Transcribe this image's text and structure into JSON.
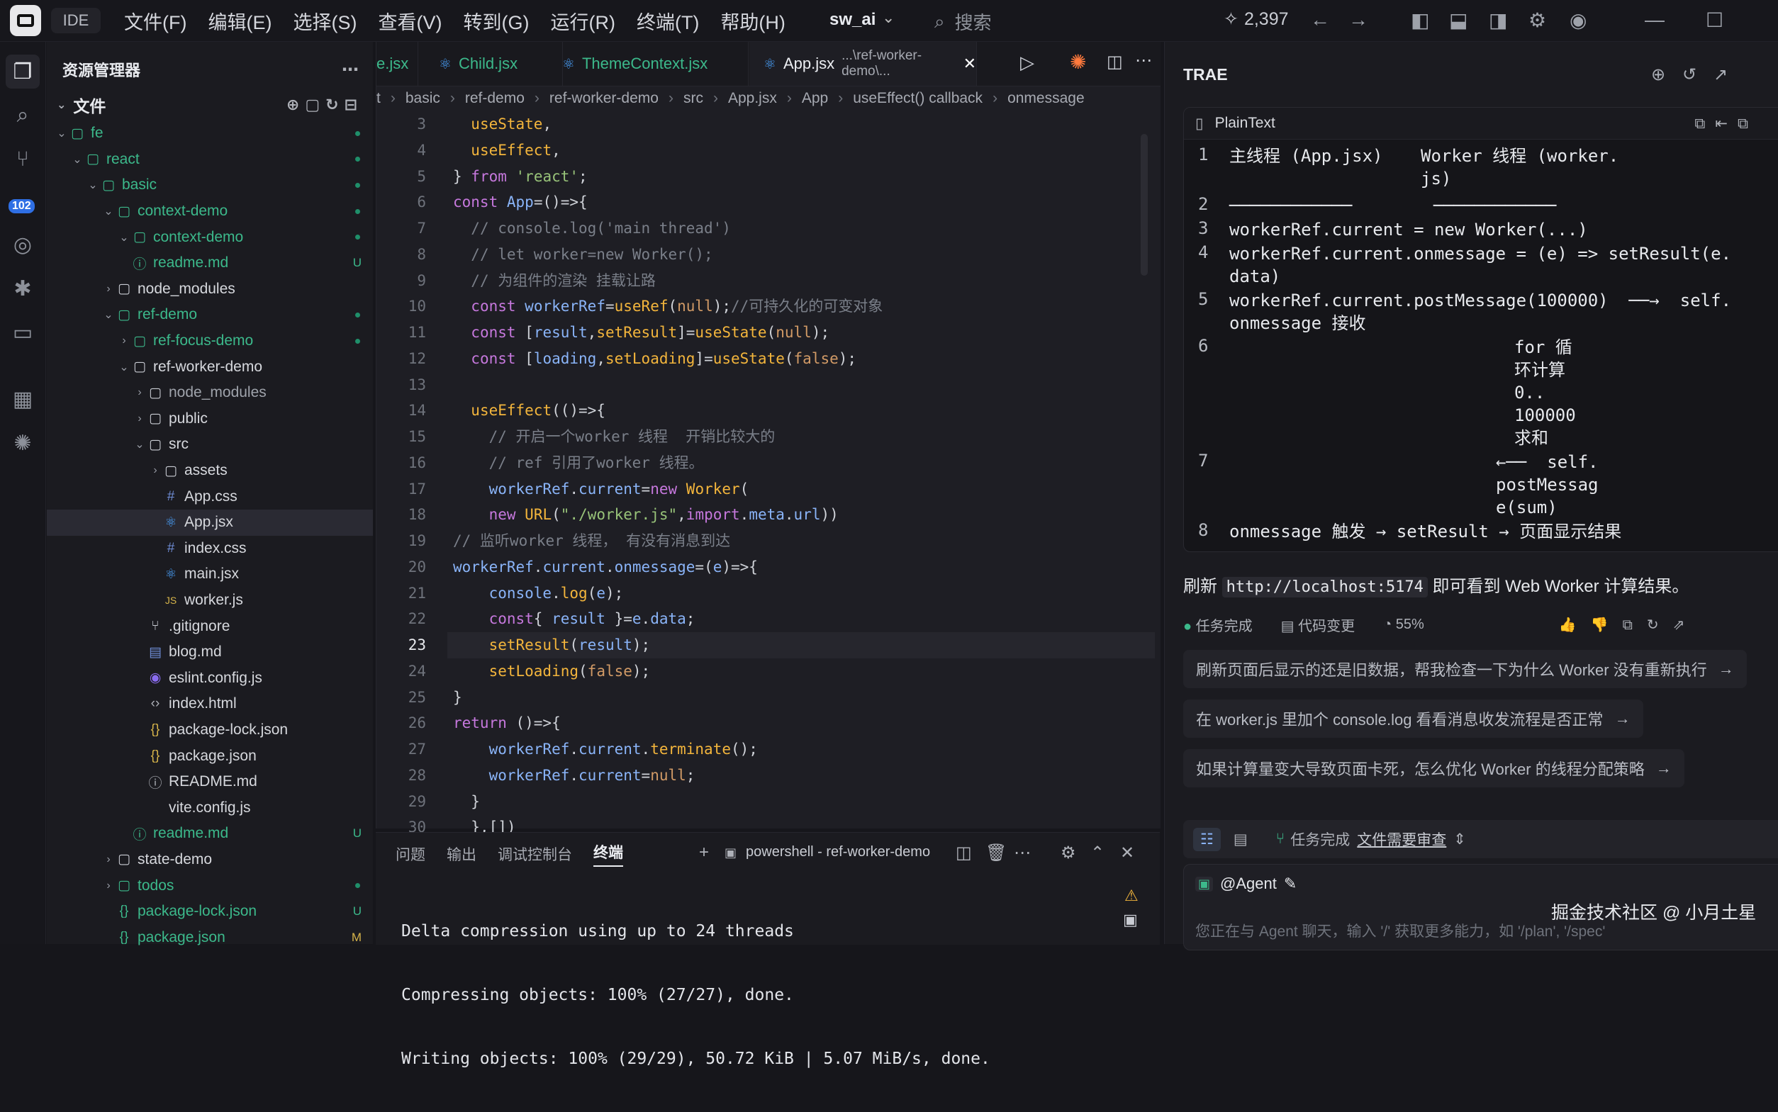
{
  "titlebar": {
    "ide_label": "IDE",
    "menus": [
      "文件(F)",
      "编辑(E)",
      "选择(S)",
      "查看(V)",
      "转到(G)",
      "运行(R)",
      "终端(T)",
      "帮助(H)"
    ],
    "project": "sw_ai",
    "search_placeholder": "搜索",
    "credits": "2,397"
  },
  "activity": {
    "badge": "102"
  },
  "sidebar": {
    "title": "资源管理器",
    "section": "文件",
    "tree": [
      {
        "label": "fe",
        "depth": 0,
        "kind": "folder",
        "open": true,
        "color": "green",
        "status": "dot"
      },
      {
        "label": "react",
        "depth": 1,
        "kind": "folder",
        "open": true,
        "color": "green",
        "status": "dot"
      },
      {
        "label": "basic",
        "depth": 2,
        "kind": "folder",
        "open": true,
        "color": "green",
        "status": "dot"
      },
      {
        "label": "context-demo",
        "depth": 3,
        "kind": "folder",
        "open": true,
        "color": "green",
        "status": "dot"
      },
      {
        "label": "context-demo",
        "depth": 4,
        "kind": "folder",
        "open": true,
        "color": "green",
        "status": "dot"
      },
      {
        "label": "readme.md",
        "depth": 4,
        "kind": "info",
        "color": "green",
        "status": "U"
      },
      {
        "label": "node_modules",
        "depth": 3,
        "kind": "folder",
        "open": false,
        "color": "white",
        "status": ""
      },
      {
        "label": "ref-demo",
        "depth": 3,
        "kind": "folder",
        "open": true,
        "color": "green",
        "status": "dot"
      },
      {
        "label": "ref-focus-demo",
        "depth": 4,
        "kind": "folder",
        "open": false,
        "color": "green",
        "status": "dot"
      },
      {
        "label": "ref-worker-demo",
        "depth": 4,
        "kind": "folder",
        "open": true,
        "color": "white",
        "status": ""
      },
      {
        "label": "node_modules",
        "depth": 5,
        "kind": "folder",
        "open": false,
        "color": "muted",
        "status": ""
      },
      {
        "label": "public",
        "depth": 5,
        "kind": "folder",
        "open": false,
        "color": "white",
        "status": ""
      },
      {
        "label": "src",
        "depth": 5,
        "kind": "folder",
        "open": true,
        "color": "white",
        "status": ""
      },
      {
        "label": "assets",
        "depth": 6,
        "kind": "folder",
        "open": false,
        "color": "white",
        "status": ""
      },
      {
        "label": "App.css",
        "depth": 6,
        "kind": "css",
        "color": "white",
        "status": ""
      },
      {
        "label": "App.jsx",
        "depth": 6,
        "kind": "react",
        "color": "white",
        "status": "",
        "selected": true
      },
      {
        "label": "index.css",
        "depth": 6,
        "kind": "css",
        "color": "white",
        "status": ""
      },
      {
        "label": "main.jsx",
        "depth": 6,
        "kind": "react",
        "color": "white",
        "status": ""
      },
      {
        "label": "worker.js",
        "depth": 6,
        "kind": "js",
        "color": "white",
        "status": ""
      },
      {
        "label": ".gitignore",
        "depth": 5,
        "kind": "git",
        "color": "white",
        "status": ""
      },
      {
        "label": "blog.md",
        "depth": 5,
        "kind": "md",
        "color": "white",
        "status": ""
      },
      {
        "label": "eslint.config.js",
        "depth": 5,
        "kind": "eslint",
        "color": "white",
        "status": ""
      },
      {
        "label": "index.html",
        "depth": 5,
        "kind": "html",
        "color": "white",
        "status": ""
      },
      {
        "label": "package-lock.json",
        "depth": 5,
        "kind": "json",
        "color": "white",
        "status": ""
      },
      {
        "label": "package.json",
        "depth": 5,
        "kind": "json",
        "color": "white",
        "status": ""
      },
      {
        "label": "README.md",
        "depth": 5,
        "kind": "info",
        "color": "white",
        "status": ""
      },
      {
        "label": "vite.config.js",
        "depth": 5,
        "kind": "none",
        "color": "white",
        "status": ""
      },
      {
        "label": "readme.md",
        "depth": 4,
        "kind": "info",
        "color": "green",
        "status": "U"
      },
      {
        "label": "state-demo",
        "depth": 3,
        "kind": "folder",
        "open": false,
        "color": "white",
        "status": ""
      },
      {
        "label": "todos",
        "depth": 3,
        "kind": "folder",
        "open": false,
        "color": "green",
        "status": "dot"
      },
      {
        "label": "package-lock.json",
        "depth": 3,
        "kind": "json",
        "color": "green",
        "status": "U"
      },
      {
        "label": "package.json",
        "depth": 3,
        "kind": "json",
        "color": "green",
        "status": "M"
      }
    ]
  },
  "editor": {
    "tabs": [
      {
        "label": "e.jsx",
        "active": false
      },
      {
        "label": "Child.jsx",
        "active": false
      },
      {
        "label": "ThemeContext.jsx",
        "active": false
      },
      {
        "label": "App.jsx",
        "path": "...\\ref-worker-demo\\...",
        "active": true
      }
    ],
    "breadcrumb": [
      "t",
      "basic",
      "ref-demo",
      "ref-worker-demo",
      "src",
      "App.jsx",
      "App",
      "useEffect() callback",
      "onmessage"
    ],
    "current_line": "23",
    "lines": [
      {
        "n": "3",
        "code": "  useState,"
      },
      {
        "n": "4",
        "code": "  useEffect,"
      },
      {
        "n": "5",
        "code": "} from 'react';"
      },
      {
        "n": "6",
        "code": "const App=()=>{"
      },
      {
        "n": "7",
        "code": "  // console.log('main thread')"
      },
      {
        "n": "8",
        "code": "  // let worker=new Worker();"
      },
      {
        "n": "9",
        "code": "  // 为组件的渲染 挂载让路"
      },
      {
        "n": "10",
        "code": "  const workerRef=useRef(null);//可持久化的可变对象"
      },
      {
        "n": "11",
        "code": "  const [result,setResult]=useState(null);"
      },
      {
        "n": "12",
        "code": "  const [loading,setLoading]=useState(false);"
      },
      {
        "n": "13",
        "code": ""
      },
      {
        "n": "14",
        "code": "  useEffect(()=>{"
      },
      {
        "n": "15",
        "code": "    // 开启一个worker 线程  开销比较大的"
      },
      {
        "n": "16",
        "code": "    // ref 引用了worker 线程。"
      },
      {
        "n": "17",
        "code": "    workerRef.current=new Worker("
      },
      {
        "n": "18",
        "code": "    new URL(\"./worker.js\",import.meta.url))"
      },
      {
        "n": "19",
        "code": "// 监听worker 线程， 有没有消息到达"
      },
      {
        "n": "20",
        "code": "workerRef.current.onmessage=(e)=>{"
      },
      {
        "n": "21",
        "code": "    console.log(e);"
      },
      {
        "n": "22",
        "code": "    const{ result }=e.data;"
      },
      {
        "n": "23",
        "code": "    setResult(result);"
      },
      {
        "n": "24",
        "code": "    setLoading(false);"
      },
      {
        "n": "25",
        "code": "}"
      },
      {
        "n": "26",
        "code": "return ()=>{"
      },
      {
        "n": "27",
        "code": "    workerRef.current.terminate();"
      },
      {
        "n": "28",
        "code": "    workerRef.current=null;"
      },
      {
        "n": "29",
        "code": "  }"
      },
      {
        "n": "30",
        "code": "  },[])"
      }
    ]
  },
  "panel": {
    "tabs": [
      "问题",
      "输出",
      "调试控制台",
      "终端"
    ],
    "active_tab": "终端",
    "terminal_name": "powershell - ref-worker-demo",
    "output": [
      "Delta compression using up to 24 threads",
      "Compressing objects: 100% (27/27), done.",
      "Writing objects: 100% (29/29), 50.72 KiB | 5.07 MiB/s, done."
    ]
  },
  "ai": {
    "title": "TRAE",
    "code_lang": "PlainText",
    "code_lines": [
      {
        "n": "1",
        "left": "主线程 (App.jsx)",
        "right": "Worker 线程 (worker.\njs)"
      },
      {
        "n": "2",
        "left": "────────────",
        "right": "────────────"
      },
      {
        "n": "3",
        "left": "workerRef.current = new Worker(...)",
        "right": ""
      },
      {
        "n": "4",
        "left": "workerRef.current.onmessage = (e) => setResult(e.\ndata)",
        "right": ""
      },
      {
        "n": "5",
        "left": "workerRef.current.postMessage(100000)  ──→  self.\nonmessage 接收",
        "right": ""
      },
      {
        "n": "6",
        "left": "",
        "right": "for 循\n环计算\n0..\n100000\n求和"
      },
      {
        "n": "7",
        "left": "",
        "right": "←──  self.\npostMessag\ne(sum)"
      },
      {
        "n": "8",
        "left": "onmessage 触发 → setResult → 页面显示结果",
        "right": ""
      }
    ],
    "refresh_prefix": "刷新",
    "refresh_url": "http://localhost:5174",
    "refresh_suffix": "即可看到 Web Worker 计算结果。",
    "status_done": "任务完成",
    "status_changes": "代码变更",
    "status_percent": "55%",
    "suggestions": [
      "刷新页面后显示的还是旧数据，帮我检查一下为什么 Worker 没有重新执行",
      "在 worker.js 里加个 console.log 看看消息收发流程是否正常",
      "如果计算量变大导致页面卡死，怎么优化 Worker 的线程分配策略"
    ],
    "task_done": "任务完成",
    "review_link": "文件需要审查",
    "agent_label": "@Agent",
    "input_placeholder": "您正在与 Agent 聊天，输入 '/' 获取更多能力，如 '/plan', '/spec'"
  },
  "watermark": "掘金技术社区 @ 小月土星"
}
